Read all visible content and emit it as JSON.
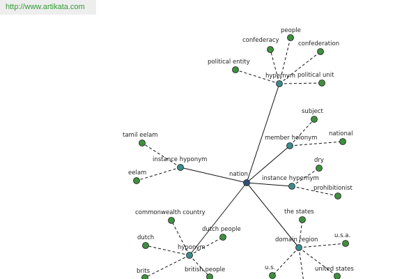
{
  "header": {
    "url": "http://www.artikata.com"
  },
  "colors": {
    "center_node": "#2e4f78",
    "relation_node": "#3d8a8a",
    "leaf_node": "#3f8f3f",
    "edge": "#111111",
    "url_text": "#339933"
  },
  "graph": {
    "center": {
      "id": "nation",
      "label": "nation"
    },
    "relations": [
      {
        "id": "hypernym",
        "label": "hypernym",
        "leaves": [
          {
            "id": "confederacy",
            "label": "confederacy"
          },
          {
            "id": "people",
            "label": "people"
          },
          {
            "id": "confederation",
            "label": "confederation"
          },
          {
            "id": "political-entity",
            "label": "political entity"
          },
          {
            "id": "political-unit",
            "label": "political unit"
          }
        ]
      },
      {
        "id": "member-holonym",
        "label": "member holonym",
        "leaves": [
          {
            "id": "subject",
            "label": "subject"
          },
          {
            "id": "national",
            "label": "national"
          }
        ]
      },
      {
        "id": "instance-hyponym",
        "label": "instance hyponym",
        "leaves": [
          {
            "id": "tamil-eelam",
            "label": "tamil eelam"
          },
          {
            "id": "eelam",
            "label": "eelam"
          }
        ]
      },
      {
        "id": "instance-hypernym",
        "label": "instance hypernym",
        "leaves": [
          {
            "id": "dry",
            "label": "dry"
          },
          {
            "id": "prohibitionist",
            "label": "prohibitionist"
          }
        ]
      },
      {
        "id": "hyponym",
        "label": "hyponym",
        "leaves": [
          {
            "id": "commonwealth-country",
            "label": "commonwealth country"
          },
          {
            "id": "dutch-people",
            "label": "dutch people"
          },
          {
            "id": "dutch",
            "label": "dutch"
          },
          {
            "id": "brits",
            "label": "brits"
          },
          {
            "id": "british-people",
            "label": "british people"
          }
        ]
      },
      {
        "id": "domain-region",
        "label": "domain region",
        "leaves": [
          {
            "id": "the-states",
            "label": "the states"
          },
          {
            "id": "usa",
            "label": "u.s.a."
          },
          {
            "id": "us",
            "label": "u.s."
          },
          {
            "id": "united-states",
            "label": "united states"
          },
          {
            "id": "domain-leaf-bottom",
            "label": ""
          }
        ]
      }
    ]
  }
}
